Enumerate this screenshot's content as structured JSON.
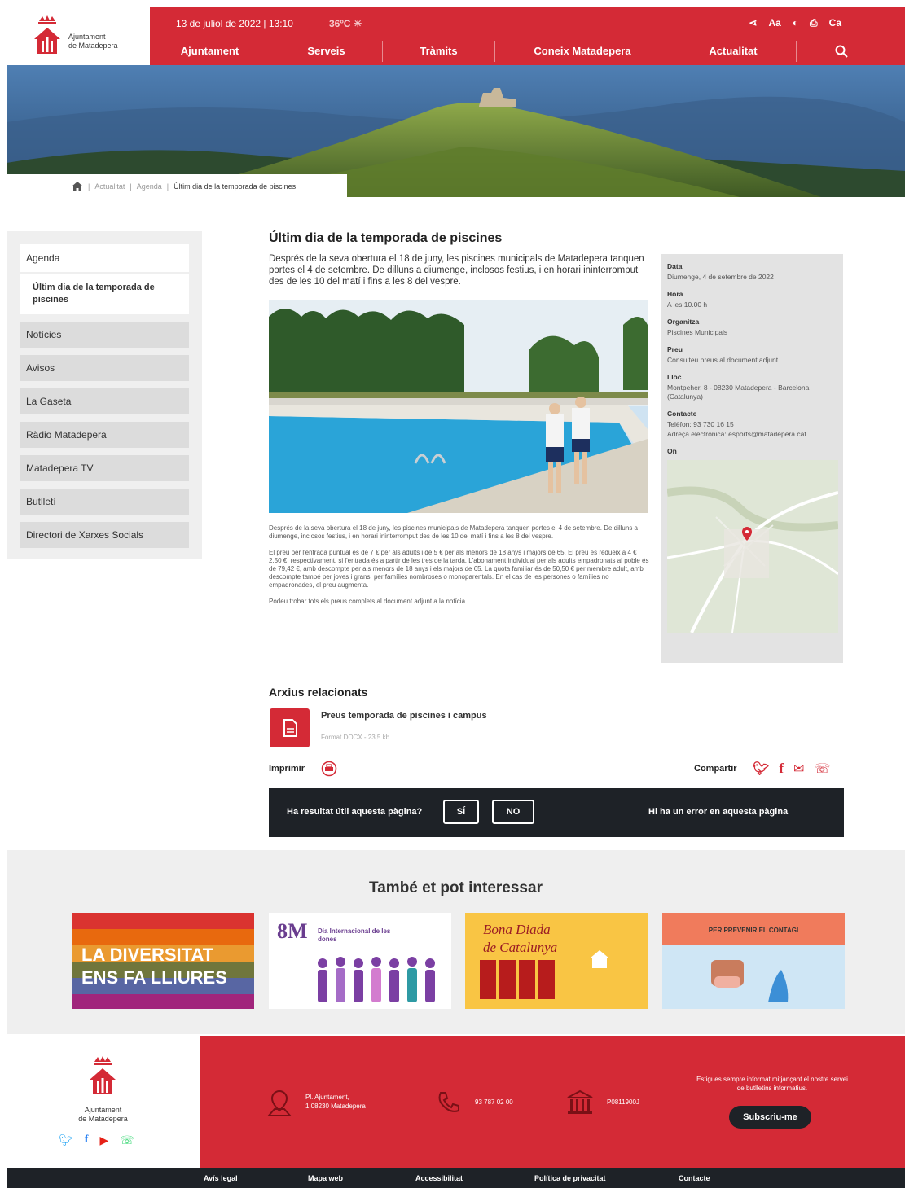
{
  "header": {
    "org_name_line1": "Ajuntament",
    "org_name_line2": "de Matadepera",
    "date_time": "13 de juliol de 2022 | 13:10",
    "temperature": "36ºC",
    "language": "Ca",
    "nav": [
      "Ajuntament",
      "Serveis",
      "Tràmits",
      "Coneix Matadepera",
      "Actualitat"
    ]
  },
  "breadcrumb": {
    "items": [
      "Actualitat",
      "Agenda"
    ],
    "current": "Últim dia de la temporada de piscines"
  },
  "sidebar": {
    "heading": "Agenda",
    "active_item": "Últim dia de la temporada de piscines",
    "items": [
      "Notícies",
      "Avisos",
      "La Gaseta",
      "Ràdio Matadepera",
      "Matadepera TV",
      "Butlletí",
      "Directori de Xarxes Socials"
    ]
  },
  "article": {
    "title": "Últim dia de la temporada de piscines",
    "lead": "Després de la seva obertura el 18 de juny, les piscines municipals de Matadepera tanquen portes el 4 de setembre. De dilluns a diumenge, inclosos festius, i en horari ininterromput des de les 10 del matí i fins a les 8 del vespre.",
    "paragraphs": [
      "Després de la seva obertura el 18 de juny, les piscines municipals de Matadepera tanquen portes el 4 de setembre. De dilluns a diumenge, inclosos festius, i en horari ininterromput des de les 10 del matí i fins a les 8 del vespre.",
      "El preu per l'entrada puntual és de 7 € per als adults i de 5 € per als menors de 18 anys i majors de 65. El preu es redueix a 4 € i 2,50 €, respectivament, si l'entrada és a partir de les tres de la tarda. L'abonament individual per als adults empadronats al poble és de 79,42 €, amb descompte per als menors de 18 anys i els majors de 65. La quota familiar és de 50,50 € per membre adult, amb descompte també per joves i grans, per famílies nombroses o monoparentals. En el cas de les persones o famílies no empadronades, el preu augmenta.",
      "Podeu trobar tots els preus complets al document adjunt a la notícia."
    ]
  },
  "info_panel": {
    "fields": [
      {
        "label": "Data",
        "value": "Diumenge, 4 de setembre de 2022"
      },
      {
        "label": "Hora",
        "value": "A les 10.00 h"
      },
      {
        "label": "Organitza",
        "value": "Piscines Municipals"
      },
      {
        "label": "Preu",
        "value": "Consulteu preus al document adjunt"
      },
      {
        "label": "Lloc",
        "value": "Montpeher, 8 - 08230 Matadepera - Barcelona (Catalunya)"
      },
      {
        "label": "Contacte",
        "value": "Telèfon: 93 730 16 15"
      },
      {
        "label": "",
        "value": "Adreça electrònica: esports@matadepera.cat"
      }
    ],
    "map_label": "On"
  },
  "files": {
    "title": "Arxius relacionats",
    "items": [
      {
        "name": "Preus temporada de piscines i campus",
        "meta": "Format DOCX - 23,5 kb"
      }
    ]
  },
  "actions": {
    "print_label": "Imprimir",
    "share_label": "Compartir"
  },
  "feedback": {
    "question": "Ha resultat útil aquesta pàgina?",
    "yes": "SÍ",
    "no": "NO",
    "error_link": "Hi ha un error en aquesta pàgina"
  },
  "related": {
    "title": "També et pot interessar",
    "cards": [
      {
        "line1": "LA DIVERSITAT",
        "line2": "ENS FA LLIURES"
      },
      {
        "badge": "8M",
        "caption": "Dia Internacional de les dones"
      },
      {
        "line1": "Bona Diada",
        "line2": "de Catalunya"
      },
      {
        "header": "PER PREVENIR EL CONTAGI"
      }
    ]
  },
  "footer": {
    "address_line1": "Pl. Ajuntament,",
    "address_line2": "1,08230 Matadepera",
    "phone": "93 787 02 00",
    "nif": "P0811900J",
    "newsletter_text": "Estigues sempre informat mitjançant el nostre servei de butlletins informatius.",
    "subscribe_label": "Subscriu-me",
    "links": [
      "Avís legal",
      "Mapa web",
      "Accessibilitat",
      "Política de privacitat",
      "Contacte"
    ]
  },
  "colors": {
    "brand_red": "#d42a36",
    "dark": "#1e2227",
    "panel_gray": "#e3e3e3"
  }
}
